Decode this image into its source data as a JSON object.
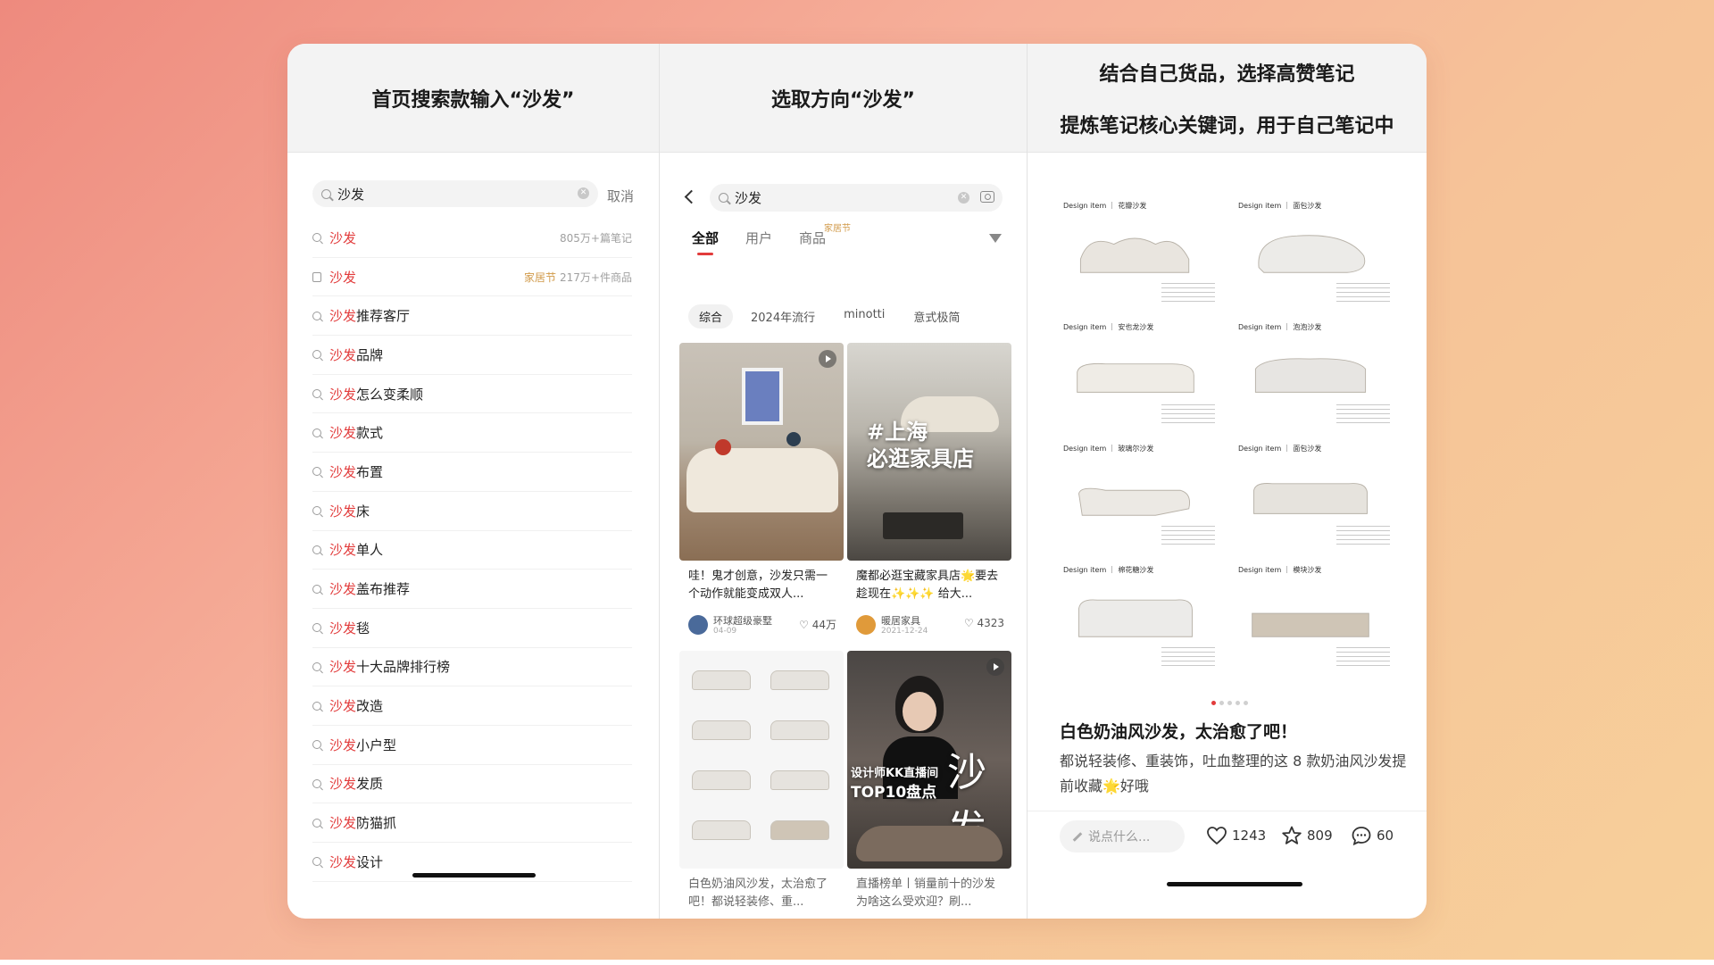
{
  "headers": {
    "col1": [
      "首页搜索款输入“沙发”"
    ],
    "col2": [
      "选取方向“沙发”"
    ],
    "col3": [
      "结合自己货品，选择高赞笔记",
      "提炼笔记核心关键词，用于自己笔记中"
    ]
  },
  "search_page": {
    "query": "沙发",
    "cancel": "取消",
    "suggestions": [
      {
        "kw": "沙发",
        "rest": "",
        "meta": "805万+篇笔记",
        "tag": "",
        "icon": "search-icon"
      },
      {
        "kw": "沙发",
        "rest": "",
        "meta": "217万+件商品",
        "tag": "家居节",
        "icon": "bag-icon"
      },
      {
        "kw": "沙发",
        "rest": "推荐客厅",
        "meta": "",
        "tag": "",
        "icon": "search-icon"
      },
      {
        "kw": "沙发",
        "rest": "品牌",
        "meta": "",
        "tag": "",
        "icon": "search-icon"
      },
      {
        "kw": "沙发",
        "rest": "怎么变柔顺",
        "meta": "",
        "tag": "",
        "icon": "search-icon"
      },
      {
        "kw": "沙发",
        "rest": "款式",
        "meta": "",
        "tag": "",
        "icon": "search-icon"
      },
      {
        "kw": "沙发",
        "rest": "布置",
        "meta": "",
        "tag": "",
        "icon": "search-icon"
      },
      {
        "kw": "沙发",
        "rest": "床",
        "meta": "",
        "tag": "",
        "icon": "search-icon"
      },
      {
        "kw": "沙发",
        "rest": "单人",
        "meta": "",
        "tag": "",
        "icon": "search-icon"
      },
      {
        "kw": "沙发",
        "rest": "盖布推荐",
        "meta": "",
        "tag": "",
        "icon": "search-icon"
      },
      {
        "kw": "沙发",
        "rest": "毯",
        "meta": "",
        "tag": "",
        "icon": "search-icon"
      },
      {
        "kw": "沙发",
        "rest": "十大品牌排行榜",
        "meta": "",
        "tag": "",
        "icon": "search-icon"
      },
      {
        "kw": "沙发",
        "rest": "改造",
        "meta": "",
        "tag": "",
        "icon": "search-icon"
      },
      {
        "kw": "沙发",
        "rest": "小户型",
        "meta": "",
        "tag": "",
        "icon": "search-icon"
      },
      {
        "kw": "沙发",
        "rest": "发质",
        "meta": "",
        "tag": "",
        "icon": "search-icon"
      },
      {
        "kw": "沙发",
        "rest": "防猫抓",
        "meta": "",
        "tag": "",
        "icon": "search-icon"
      },
      {
        "kw": "沙发",
        "rest": "设计",
        "meta": "",
        "tag": "",
        "icon": "search-icon"
      }
    ]
  },
  "results_page": {
    "query": "沙发",
    "tabs": [
      "全部",
      "用户",
      "商品"
    ],
    "tab_badge": "家居节",
    "chips": [
      "综合",
      "2024年流行",
      "minotti",
      "意式极简"
    ],
    "cards": [
      {
        "title": "哇！鬼才创意，沙发只需一个动作就能变成双人...",
        "author": "环球超级豪墅",
        "date": "04-09",
        "likes": "44万"
      },
      {
        "title": "魔都必逛宝藏家具店🌟要去趁现在✨✨✨ 给大...",
        "author": "暖居家具",
        "date": "2021-12-24",
        "likes": "4323",
        "overlay": [
          "#上海",
          "必逛家具店"
        ]
      },
      {
        "title": "白色奶油风沙发，太治愈了吧！都说轻装修、重..."
      },
      {
        "title": "直播榜单丨销量前十的沙发 为啥这么受欢迎？刷...",
        "overlay": [
          "设计师KK直播间",
          "TOP10盘点",
          "沙发"
        ]
      }
    ]
  },
  "note_page": {
    "items": [
      {
        "label": "Design item ｜ 花瓣沙发"
      },
      {
        "label": "Design item ｜ 面包沙发"
      },
      {
        "label": "Design item ｜ 安也龙沙发"
      },
      {
        "label": "Design item ｜ 泡泡沙发"
      },
      {
        "label": "Design item ｜ 玻璃尔沙发"
      },
      {
        "label": "Design item ｜ 面包沙发"
      },
      {
        "label": "Design item ｜ 棉花糖沙发"
      },
      {
        "label": "Design item ｜ 模块沙发"
      }
    ],
    "title": "白色奶油风沙发，太治愈了吧！",
    "body": "都说轻装修、重装饰，吐血整理的这 8 款奶油风沙发提前收藏🌟好哦",
    "input_placeholder": "说点什么...",
    "likes": "1243",
    "collects": "809",
    "comments": "60"
  },
  "colors": {
    "accent": "#e23b3b",
    "tag": "#d19a4a"
  }
}
